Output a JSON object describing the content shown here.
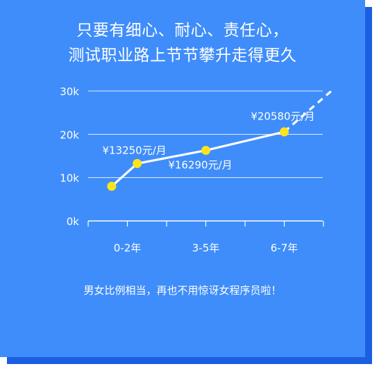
{
  "headline": {
    "line1": "只要有细心、耐心、责任心，",
    "line2": "测试职业路上节节攀升走得更久"
  },
  "footer_note": "男女比例相当，再也不用惊讶女程序员啦！",
  "colors": {
    "card": "#3f8dfa",
    "card_shadow": "#1b5fe0",
    "line": "#ffffff",
    "point": "#ffe41a"
  },
  "chart_data": {
    "type": "line",
    "title": "",
    "xlabel": "",
    "ylabel": "",
    "y_tick_labels": [
      "0k",
      "10k",
      "20k",
      "30k"
    ],
    "y_ticks": [
      0,
      10000,
      20000,
      30000
    ],
    "ylim": [
      0,
      30000
    ],
    "x_tick_labels": [
      "0-2年",
      "3-5年",
      "6-7年"
    ],
    "grid": true,
    "series": [
      {
        "points": [
          {
            "x": 0.6,
            "y": 8000
          },
          {
            "x": 1.25,
            "y": 13250,
            "label": "¥13250元/月"
          },
          {
            "x": 3.0,
            "y": 16290,
            "label": "¥16290元/月"
          },
          {
            "x": 5.0,
            "y": 20580,
            "label": "¥20580元/月"
          }
        ],
        "projection": {
          "x": 6.2,
          "y": 30000
        }
      }
    ]
  }
}
